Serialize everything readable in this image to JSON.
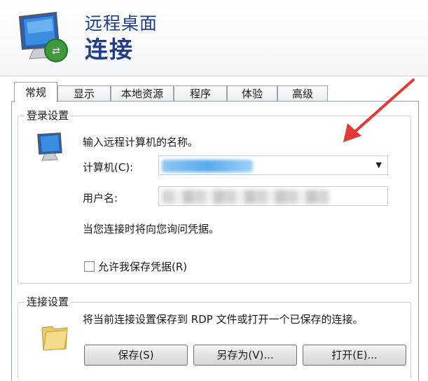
{
  "header": {
    "subtitle": "远程桌面",
    "title": "连接"
  },
  "tabs": [
    {
      "label": "常规",
      "active": true
    },
    {
      "label": "显示"
    },
    {
      "label": "本地资源"
    },
    {
      "label": "程序"
    },
    {
      "label": "体验"
    },
    {
      "label": "高级"
    }
  ],
  "login": {
    "group_title": "登录设置",
    "instruction": "输入远程计算机的名称。",
    "computer_label": "计算机(C):",
    "user_label": "用户名:",
    "credentials_hint": "当您连接时将向您询问凭据。",
    "save_credentials_label": "允许我保存凭据(R)",
    "save_credentials_checked": false
  },
  "connection": {
    "group_title": "连接设置",
    "description": "将当前连接设置保存到 RDP 文件或打开一个已保存的连接。",
    "save_button": "保存(S)",
    "save_as_button": "另存为(V)...",
    "open_button": "打开(E)..."
  },
  "colors": {
    "title": "#1e3d8a",
    "arrow": "#e53935"
  }
}
